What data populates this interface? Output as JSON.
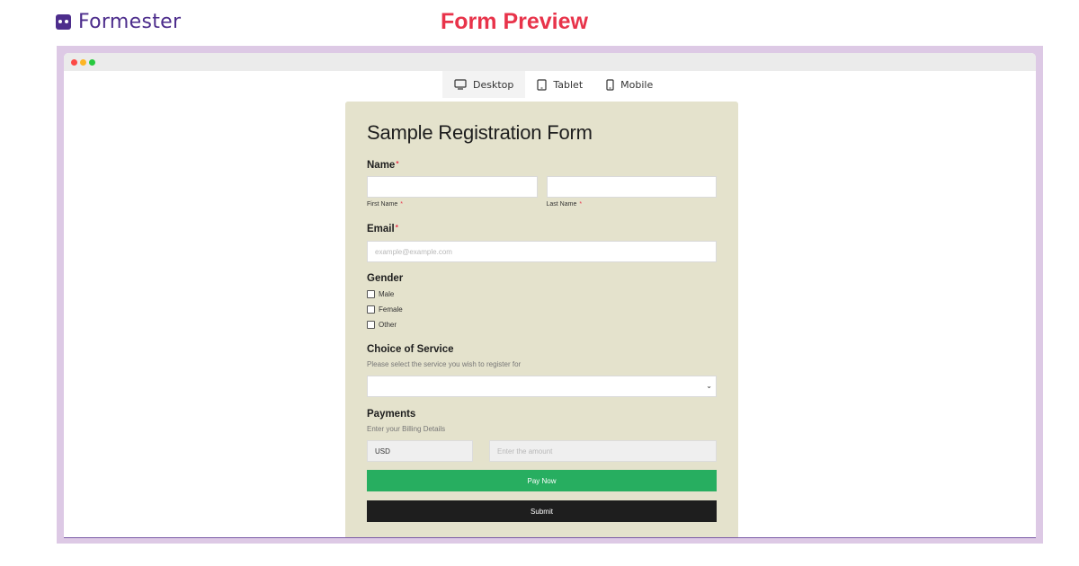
{
  "brand": {
    "name": "Formester"
  },
  "heading": "Form Preview",
  "device_tabs": [
    {
      "label": "Desktop",
      "icon": "desktop-icon",
      "active": true
    },
    {
      "label": "Tablet",
      "icon": "tablet-icon",
      "active": false
    },
    {
      "label": "Mobile",
      "icon": "mobile-icon",
      "active": false
    }
  ],
  "form": {
    "title": "Sample Registration Form",
    "name": {
      "label": "Name",
      "required_mark": "*",
      "first_label": "First Name",
      "last_label": "Last Name",
      "first_value": "",
      "last_value": ""
    },
    "email": {
      "label": "Email",
      "required_mark": "*",
      "placeholder": "example@example.com",
      "value": ""
    },
    "gender": {
      "label": "Gender",
      "options": [
        "Male",
        "Female",
        "Other"
      ]
    },
    "service": {
      "label": "Choice of Service",
      "hint": "Please select the service you wish to register for",
      "selected": ""
    },
    "payments": {
      "label": "Payments",
      "hint": "Enter your Billing Details",
      "currency": "USD",
      "amount_placeholder": "Enter the amount",
      "pay_button": "Pay Now"
    },
    "submit_button": "Submit"
  },
  "colors": {
    "brand": "#4d2d8c",
    "heading": "#e8334a",
    "frame": "#ddc9e5",
    "form_bg": "#e4e2cc",
    "pay_button": "#27ae60",
    "submit_button": "#1e1e1e"
  }
}
